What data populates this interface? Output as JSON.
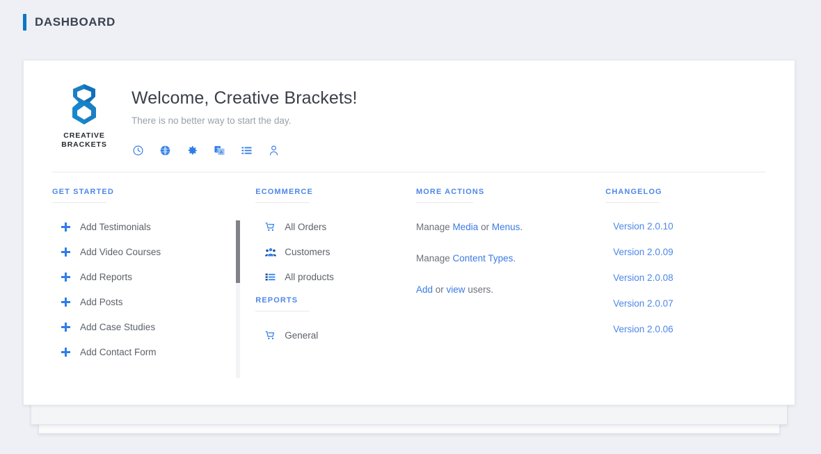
{
  "page": {
    "title": "DASHBOARD",
    "accent_color": "#0b76c4"
  },
  "brand": {
    "logo_icon": "creative-brackets-logo",
    "name_line1": "CREATIVE",
    "name_line2": "BRACKETS",
    "logo_color": "#1b7fc4"
  },
  "welcome": {
    "title": "Welcome, Creative Brackets!",
    "subtitle": "There is no better way to start the day."
  },
  "quick_icons": [
    {
      "name": "clock-icon"
    },
    {
      "name": "globe-icon"
    },
    {
      "name": "gear-icon"
    },
    {
      "name": "translate-icon"
    },
    {
      "name": "list-icon"
    },
    {
      "name": "user-icon"
    }
  ],
  "columns": {
    "get_started": {
      "heading": "GET STARTED",
      "items": [
        {
          "label": "Add Testimonials",
          "icon": "plus-icon"
        },
        {
          "label": "Add Video Courses",
          "icon": "plus-icon"
        },
        {
          "label": "Add Reports",
          "icon": "plus-icon"
        },
        {
          "label": "Add Posts",
          "icon": "plus-icon"
        },
        {
          "label": "Add Case Studies",
          "icon": "plus-icon"
        },
        {
          "label": "Add Contact Form",
          "icon": "plus-icon"
        }
      ]
    },
    "ecommerce": {
      "heading": "ECOMMERCE",
      "items": [
        {
          "label": "All Orders",
          "icon": "cart-icon"
        },
        {
          "label": "Customers",
          "icon": "users-icon"
        },
        {
          "label": "All products",
          "icon": "list-icon"
        }
      ]
    },
    "reports": {
      "heading": "REPORTS",
      "items": [
        {
          "label": "General",
          "icon": "cart-icon"
        }
      ]
    },
    "more_actions": {
      "heading": "MORE ACTIONS",
      "lines": [
        {
          "prefix": "Manage ",
          "link1": "Media",
          "middle": " or ",
          "link2": "Menus",
          "suffix": "."
        },
        {
          "prefix": "Manage ",
          "link1": "Content Types",
          "middle": "",
          "link2": "",
          "suffix": "."
        },
        {
          "prefix": "",
          "link1": "Add",
          "middle": " or ",
          "link2": "view",
          "suffix": " users."
        }
      ]
    },
    "changelog": {
      "heading": "CHANGELOG",
      "items": [
        {
          "label": "Version 2.0.10"
        },
        {
          "label": "Version 2.0.09"
        },
        {
          "label": "Version 2.0.08"
        },
        {
          "label": "Version 2.0.07"
        },
        {
          "label": "Version 2.0.06"
        }
      ]
    }
  },
  "scrollbar": {
    "name": "get-started-scrollbar"
  },
  "colors": {
    "link_blue": "#3b7ae4",
    "heading_blue": "#4d87e8",
    "icon_blue": "#2f7ee8",
    "body_grey": "#5c6169",
    "page_bg": "#eef0f5"
  }
}
